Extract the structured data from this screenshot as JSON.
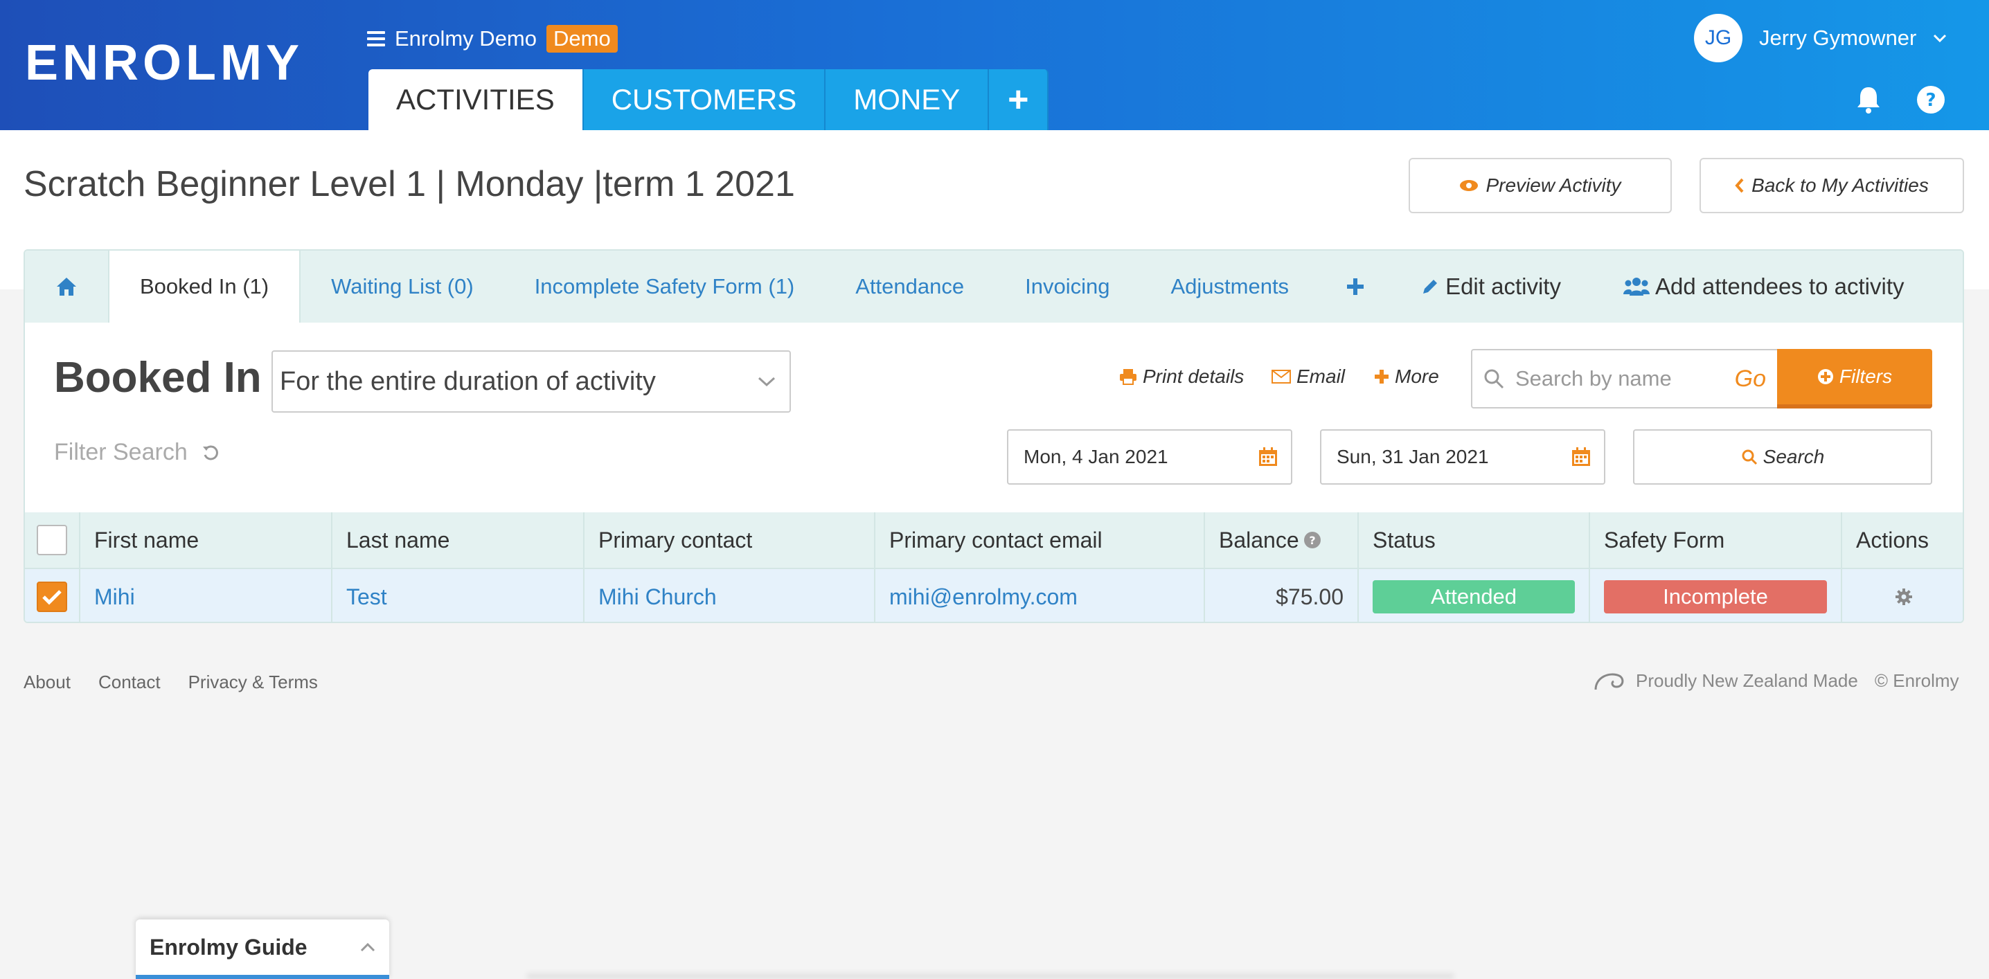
{
  "app": {
    "logo_text": "ENROLMY",
    "org_name": "Enrolmy Demo",
    "demo_badge": "Demo",
    "user_initials": "JG",
    "user_name": "Jerry Gymowner"
  },
  "main_tabs": [
    {
      "label": "ACTIVITIES",
      "active": true
    },
    {
      "label": "CUSTOMERS",
      "active": false
    },
    {
      "label": "MONEY",
      "active": false
    },
    {
      "label": "+",
      "active": false
    }
  ],
  "page": {
    "title": "Scratch Beginner Level 1 | Monday |term 1 2021",
    "preview_label": "Preview Activity",
    "back_label": "Back to My Activities"
  },
  "sub_tabs": [
    {
      "label": "Booked In (1)",
      "active": true
    },
    {
      "label": "Waiting List (0)",
      "active": false
    },
    {
      "label": "Incomplete Safety Form (1)",
      "active": false
    },
    {
      "label": "Attendance",
      "active": false
    },
    {
      "label": "Invoicing",
      "active": false
    },
    {
      "label": "Adjustments",
      "active": false
    },
    {
      "label": "Edit activity",
      "active": false
    },
    {
      "label": "Add attendees to activity",
      "active": false
    }
  ],
  "section": {
    "title": "Booked In",
    "duration_value": "For the entire duration of activity",
    "print_label": "Print details",
    "email_label": "Email",
    "more_label": "More",
    "search_placeholder": "Search by name",
    "go_label": "Go",
    "filters_label": "Filters",
    "filter_search_label": "Filter Search",
    "start_date": "Mon, 4 Jan 2021",
    "end_date": "Sun, 31 Jan 2021",
    "search_label": "Search"
  },
  "table": {
    "headers": [
      "First name",
      "Last name",
      "Primary contact",
      "Primary contact email",
      "Balance",
      "Status",
      "Safety Form",
      "Actions"
    ],
    "rows": [
      {
        "first_name": "Mihi",
        "last_name": "Test",
        "primary_contact": "Mihi Church",
        "email": "mihi@enrolmy.com",
        "balance": "$75.00",
        "status": "Attended",
        "safety_form": "Incomplete",
        "checked": true
      }
    ]
  },
  "footer": {
    "links": [
      "About",
      "Contact",
      "Privacy & Terms"
    ],
    "made_in": "Proudly New Zealand Made",
    "copyright": "© Enrolmy"
  },
  "guide": {
    "label": "Enrolmy Guide"
  },
  "colors": {
    "header_start": "#1e4fb8",
    "header_end": "#1597e8",
    "accent_orange": "#f08a1e",
    "link_blue": "#2f82c6",
    "status_green": "#5ecf97",
    "safety_red": "#e36f65"
  }
}
